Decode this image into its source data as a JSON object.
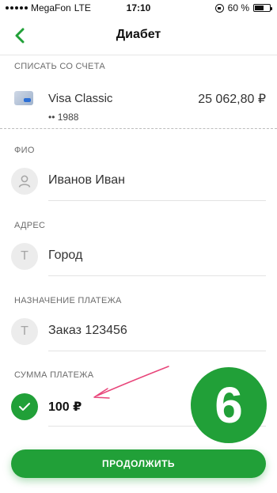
{
  "status_bar": {
    "carrier": "MegaFon",
    "network": "LTE",
    "time": "17:10",
    "battery_text": "60 %",
    "battery_level": 0.6
  },
  "header": {
    "title": "Диабет",
    "back_icon": "chevron-left-icon"
  },
  "debit": {
    "label": "СПИСАТЬ СО СЧЕТА",
    "card_name": "Visa Classic",
    "balance": "25 062,80 ₽",
    "card_number": "•• 1988"
  },
  "fio": {
    "label": "ФИО",
    "value": "Иванов Иван",
    "icon": "person-icon"
  },
  "address": {
    "label": "АДРЕС",
    "value": "Город",
    "icon_letter": "Т"
  },
  "purpose": {
    "label": "НАЗНАЧЕНИЕ ПЛАТЕЖА",
    "value": "Заказ 123456",
    "icon_letter": "Т"
  },
  "amount": {
    "label": "СУММА ПЛАТЕЖА",
    "value": "100 ₽",
    "icon": "checkmark-icon"
  },
  "step_badge": "6",
  "continue_label": "ПРОДОЛЖИТЬ",
  "colors": {
    "accent": "#21a038",
    "annotation_arrow": "#e8457a"
  }
}
